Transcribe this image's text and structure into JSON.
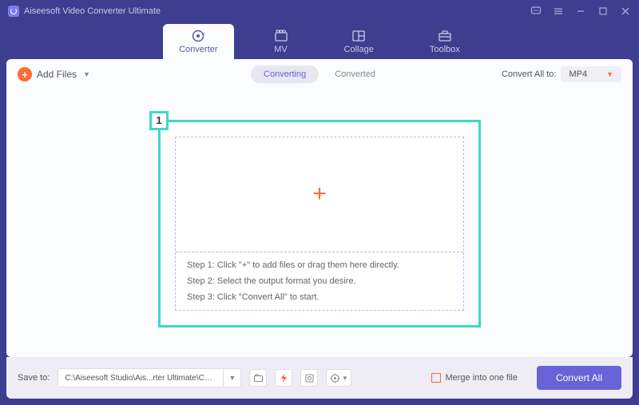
{
  "titlebar": {
    "title": "Aiseesoft Video Converter Ultimate"
  },
  "tabs": {
    "converter": "Converter",
    "mv": "MV",
    "collage": "Collage",
    "toolbox": "Toolbox"
  },
  "subbar": {
    "add_files": "Add Files",
    "converting": "Converting",
    "converted": "Converted",
    "convert_all_to": "Convert All to:",
    "format": "MP4"
  },
  "callout": {
    "badge": "1"
  },
  "steps": {
    "s1": "Step 1: Click \"+\" to add files or drag them here directly.",
    "s2": "Step 2: Select the output format you desire.",
    "s3": "Step 3: Click \"Convert All\" to start."
  },
  "footer": {
    "save_to_label": "Save to:",
    "path": "C:\\Aiseesoft Studio\\Ais...rter Ultimate\\Converted",
    "merge_label": "Merge into one file",
    "convert_all": "Convert All"
  }
}
